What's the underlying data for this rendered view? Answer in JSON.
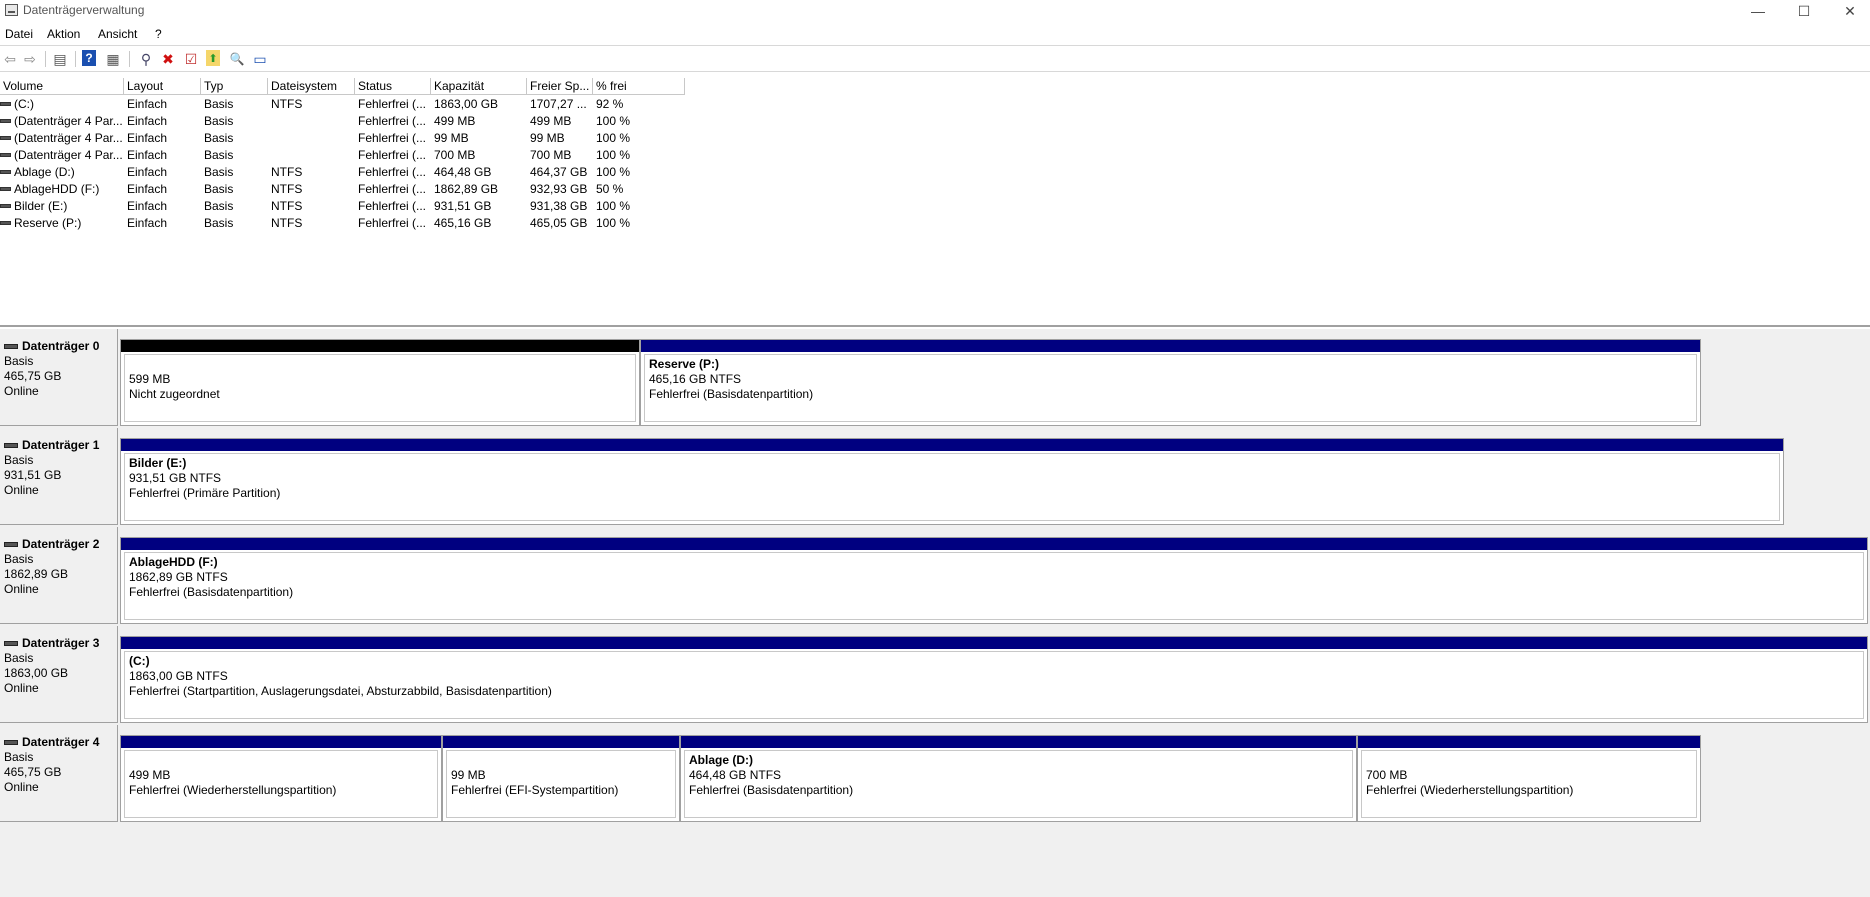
{
  "window": {
    "title": "Datenträgerverwaltung",
    "minimize": "—",
    "maximize": "☐",
    "close": "✕"
  },
  "menu": [
    "Datei",
    "Aktion",
    "Ansicht",
    "?"
  ],
  "toolbar": {
    "icons": [
      "back-arrow-icon",
      "forward-arrow-icon",
      "console-tree-icon",
      "help-icon",
      "properties-icon",
      "connect-icon",
      "delete-icon",
      "checklist-icon",
      "export-icon",
      "search-icon",
      "view-icon"
    ],
    "glyphs": [
      "⇦",
      "⇨",
      "▤",
      "?",
      "▦",
      "⚲",
      "✖",
      "☑",
      "⬆",
      "🔍",
      "▭"
    ],
    "accent_delete": "#d01010"
  },
  "volume_list": {
    "columns": [
      "Volume",
      "Layout",
      "Typ",
      "Dateisystem",
      "Status",
      "Kapazität",
      "Freier Sp...",
      "% frei"
    ],
    "rows": [
      [
        "(C:)",
        "Einfach",
        "Basis",
        "NTFS",
        "Fehlerfrei (...",
        "1863,00 GB",
        "1707,27 ...",
        "92 %"
      ],
      [
        "(Datenträger 4 Par...",
        "Einfach",
        "Basis",
        "",
        "Fehlerfrei (...",
        "499 MB",
        "499 MB",
        "100 %"
      ],
      [
        "(Datenträger 4 Par...",
        "Einfach",
        "Basis",
        "",
        "Fehlerfrei (...",
        "99 MB",
        "99 MB",
        "100 %"
      ],
      [
        "(Datenträger 4 Par...",
        "Einfach",
        "Basis",
        "",
        "Fehlerfrei (...",
        "700 MB",
        "700 MB",
        "100 %"
      ],
      [
        "Ablage (D:)",
        "Einfach",
        "Basis",
        "NTFS",
        "Fehlerfrei (...",
        "464,48 GB",
        "464,37 GB",
        "100 %"
      ],
      [
        "AblageHDD (F:)",
        "Einfach",
        "Basis",
        "NTFS",
        "Fehlerfrei (...",
        "1862,89 GB",
        "932,93 GB",
        "50 %"
      ],
      [
        "Bilder (E:)",
        "Einfach",
        "Basis",
        "NTFS",
        "Fehlerfrei (...",
        "931,51 GB",
        "931,38 GB",
        "100 %"
      ],
      [
        "Reserve (P:)",
        "Einfach",
        "Basis",
        "NTFS",
        "Fehlerfrei (...",
        "465,16 GB",
        "465,05 GB",
        "100 %"
      ]
    ]
  },
  "disks": [
    {
      "name": "Datenträger 0",
      "type": "Basis",
      "size": "465,75 GB",
      "state": "Online",
      "partitions": [
        {
          "name": "",
          "line1": "599 MB",
          "line2": "Nicht zugeordnet",
          "unallocated": true
        },
        {
          "name": "Reserve  (P:)",
          "line1": "465,16 GB NTFS",
          "line2": "Fehlerfrei (Basisdatenpartition)",
          "unallocated": false
        }
      ]
    },
    {
      "name": "Datenträger 1",
      "type": "Basis",
      "size": "931,51 GB",
      "state": "Online",
      "partitions": [
        {
          "name": "Bilder  (E:)",
          "line1": "931,51 GB NTFS",
          "line2": "Fehlerfrei (Primäre Partition)",
          "unallocated": false
        }
      ]
    },
    {
      "name": "Datenträger 2",
      "type": "Basis",
      "size": "1862,89 GB",
      "state": "Online",
      "partitions": [
        {
          "name": "AblageHDD  (F:)",
          "line1": "1862,89 GB NTFS",
          "line2": "Fehlerfrei (Basisdatenpartition)",
          "unallocated": false
        }
      ]
    },
    {
      "name": "Datenträger 3",
      "type": "Basis",
      "size": "1863,00 GB",
      "state": "Online",
      "partitions": [
        {
          "name": " (C:)",
          "line1": "1863,00 GB NTFS",
          "line2": "Fehlerfrei (Startpartition, Auslagerungsdatei, Absturzabbild, Basisdatenpartition)",
          "unallocated": false
        }
      ]
    },
    {
      "name": "Datenträger 4",
      "type": "Basis",
      "size": "465,75 GB",
      "state": "Online",
      "partitions": [
        {
          "name": "",
          "line1": "499 MB",
          "line2": "Fehlerfrei (Wiederherstellungspartition)",
          "unallocated": false
        },
        {
          "name": "",
          "line1": "99 MB",
          "line2": "Fehlerfrei (EFI-Systempartition)",
          "unallocated": false
        },
        {
          "name": "Ablage  (D:)",
          "line1": "464,48 GB NTFS",
          "line2": "Fehlerfrei (Basisdatenpartition)",
          "unallocated": false
        },
        {
          "name": "",
          "line1": "700 MB",
          "line2": "Fehlerfrei (Wiederherstellungspartition)",
          "unallocated": false
        }
      ]
    }
  ]
}
